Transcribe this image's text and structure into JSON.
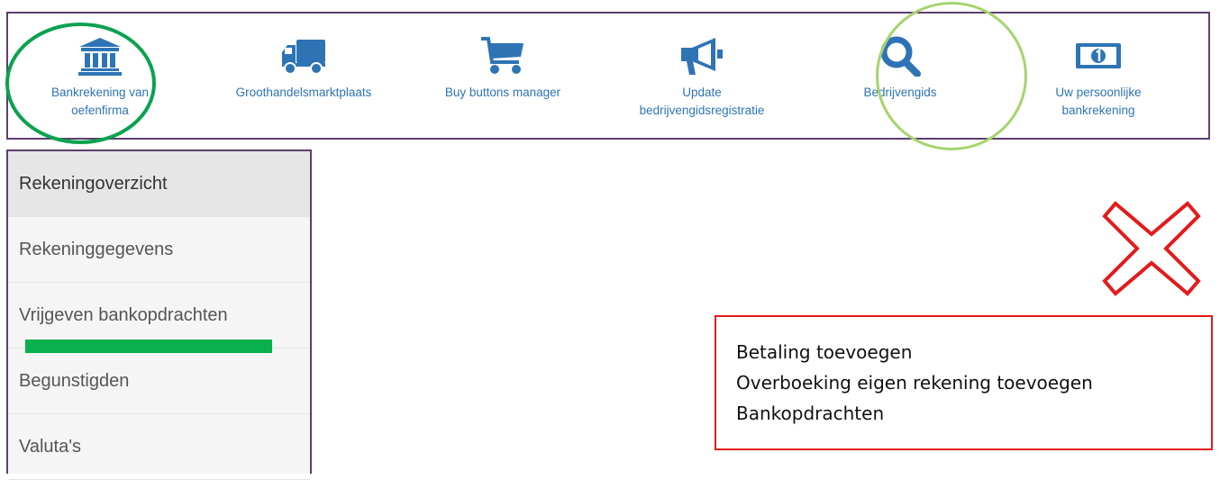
{
  "colors": {
    "nav_border": "#5b3f6e",
    "nav_icon": "#2e74b5",
    "circle_primary": "#0aa24f",
    "circle_secondary": "#a6d46d",
    "underline": "#0ab04d",
    "cross": "#e31b1b"
  },
  "top_partial_text": {
    "bold": "...",
    "light": ""
  },
  "nav": {
    "items": [
      {
        "icon": "bank-icon",
        "line1": "Bankrekening van",
        "line2": "oefenfirma"
      },
      {
        "icon": "truck-icon",
        "line1": "Groothandelsmarktplaats",
        "line2": ""
      },
      {
        "icon": "cart-icon",
        "line1": "Buy buttons manager",
        "line2": ""
      },
      {
        "icon": "megaphone-icon",
        "line1": "Update",
        "line2": "bedrijvengidsregistratie"
      },
      {
        "icon": "search-icon",
        "line1": "Bedrijvengids",
        "line2": ""
      },
      {
        "icon": "banknote-icon",
        "line1": "Uw persoonlijke",
        "line2": "bankrekening"
      }
    ]
  },
  "sidebar": {
    "items": [
      {
        "label": "Rekeningoverzicht",
        "active": true
      },
      {
        "label": "Rekeninggegevens",
        "active": false
      },
      {
        "label": "Vrijgeven bankopdrachten",
        "active": false
      },
      {
        "label": "Begunstigden",
        "active": false
      },
      {
        "label": "Valuta's",
        "active": false
      }
    ]
  },
  "red_box": {
    "lines": [
      "Betaling toevoegen",
      "Overboeking eigen rekening toevoegen",
      "Bankopdrachten"
    ]
  }
}
